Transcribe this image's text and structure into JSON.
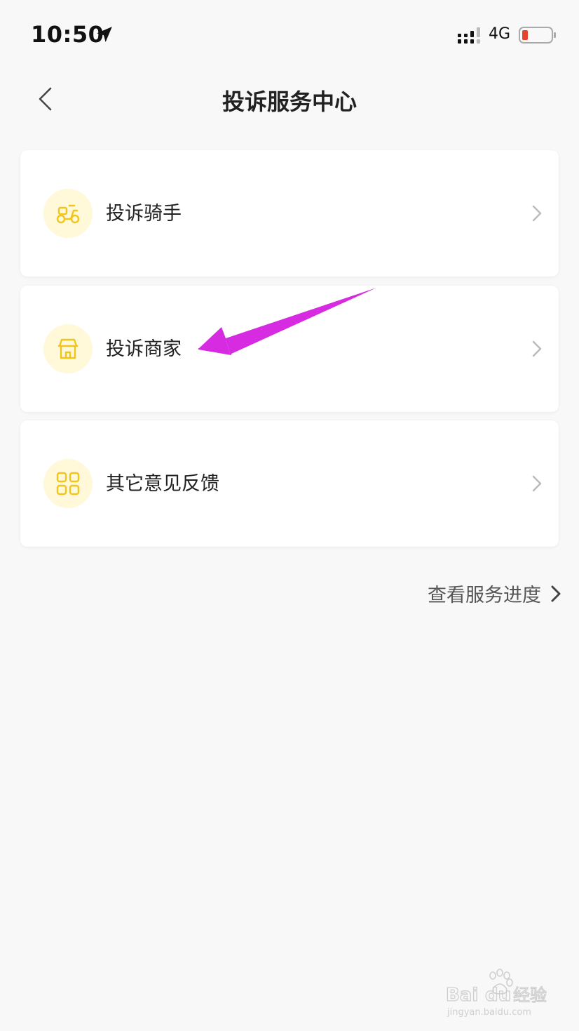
{
  "status_bar": {
    "time": "10:50",
    "network": "4G",
    "battery_color": "#e8412c"
  },
  "nav": {
    "title": "投诉服务中心"
  },
  "menu": {
    "items": [
      {
        "label": "投诉骑手",
        "icon": "scooter-icon"
      },
      {
        "label": "投诉商家",
        "icon": "store-icon"
      },
      {
        "label": "其它意见反馈",
        "icon": "grid-icon"
      }
    ]
  },
  "links": {
    "view_progress": "查看服务进度"
  },
  "colors": {
    "accent": "#f2c51c",
    "icon_bg": "#fff8d9",
    "annotation": "#d62be0"
  },
  "watermark": {
    "text": "Baidu经验",
    "url_text": "jingyan.baidu.com"
  }
}
